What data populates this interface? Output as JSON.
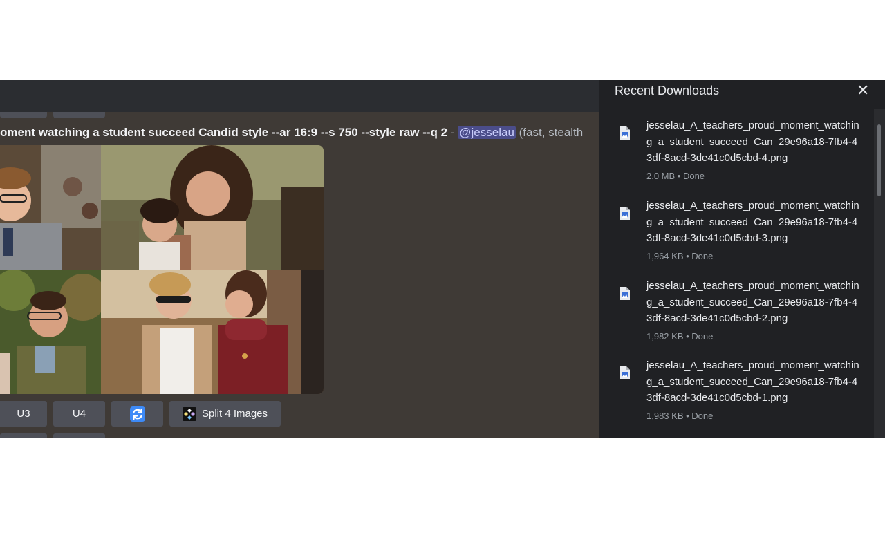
{
  "prompt": {
    "text": "oment watching a student succeed Candid style --ar 16:9 --s 750 --style raw --q 2",
    "separator": "-",
    "mention": "@jesselau",
    "suffix": "(fast, stealth"
  },
  "buttons": {
    "u3": "U3",
    "u4": "U4",
    "split": "Split 4 Images"
  },
  "downloads": {
    "title": "Recent Downloads",
    "close_label": "✕",
    "items": [
      {
        "name": "jesselau_A_teachers_proud_moment_watching_a_student_succeed_Can_29e96a18-7fb4-43df-8acd-3de41c0d5cbd-4.png",
        "meta": "2.0 MB • Done"
      },
      {
        "name": "jesselau_A_teachers_proud_moment_watching_a_student_succeed_Can_29e96a18-7fb4-43df-8acd-3de41c0d5cbd-3.png",
        "meta": "1,964 KB • Done"
      },
      {
        "name": "jesselau_A_teachers_proud_moment_watching_a_student_succeed_Can_29e96a18-7fb4-43df-8acd-3de41c0d5cbd-2.png",
        "meta": "1,982 KB • Done"
      },
      {
        "name": "jesselau_A_teachers_proud_moment_watching_a_student_succeed_Can_29e96a18-7fb4-43df-8acd-3de41c0d5cbd-1.png",
        "meta": "1,983 KB • Done"
      }
    ]
  },
  "icons": {
    "refresh": "refresh-icon",
    "split": "split-images-icon",
    "file": "image-file-icon",
    "close": "close-icon"
  },
  "colors": {
    "discord_bg": "#3f3a36",
    "button_bg": "#4e5058",
    "mention_bg": "#4b4d8a",
    "panel_bg": "#202124",
    "refresh_blue": "#3d8af7"
  }
}
